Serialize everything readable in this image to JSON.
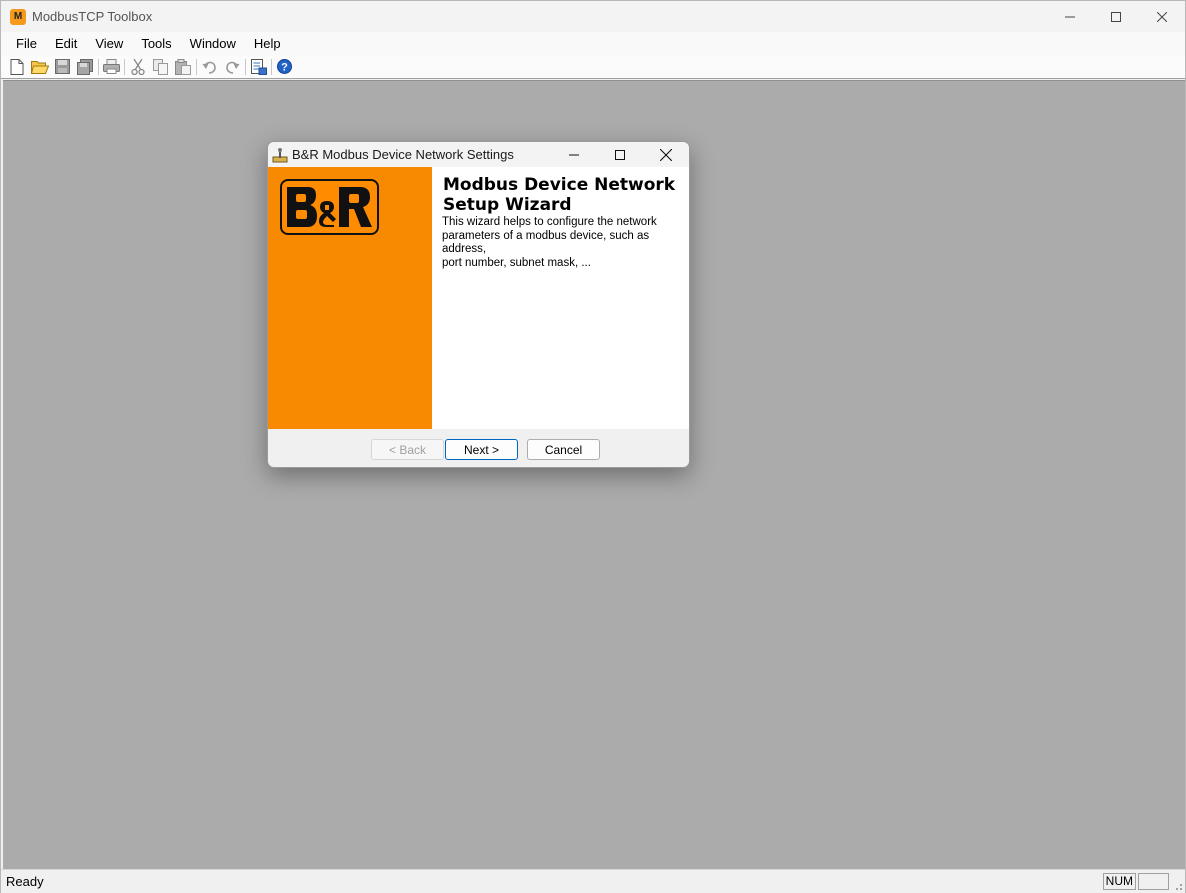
{
  "window": {
    "title": "ModbusTCP Toolbox",
    "app_icon_letter": "M"
  },
  "menu": [
    "File",
    "Edit",
    "View",
    "Tools",
    "Window",
    "Help"
  ],
  "toolbar": {
    "buttons": [
      "new-icon",
      "open-icon",
      "save-icon",
      "save-all-icon",
      "print-icon",
      "cut-icon",
      "copy-icon",
      "paste-icon",
      "undo-icon",
      "redo-icon",
      "wizard-icon",
      "help-icon"
    ]
  },
  "dialog": {
    "title": "B&R Modbus Device Network Settings",
    "heading": "Modbus Device Network\nSetup Wizard",
    "description": "This wizard helps to configure the network\nparameters of a modbus device, such as address,\nport number, subnet mask, ...",
    "buttons": {
      "back": "< Back",
      "next": "Next >",
      "cancel": "Cancel"
    },
    "logo_text": "B&R",
    "accent_color": "#f78a00"
  },
  "statusbar": {
    "text": "Ready",
    "num_indicator": "NUM",
    "empty_pane": ""
  }
}
